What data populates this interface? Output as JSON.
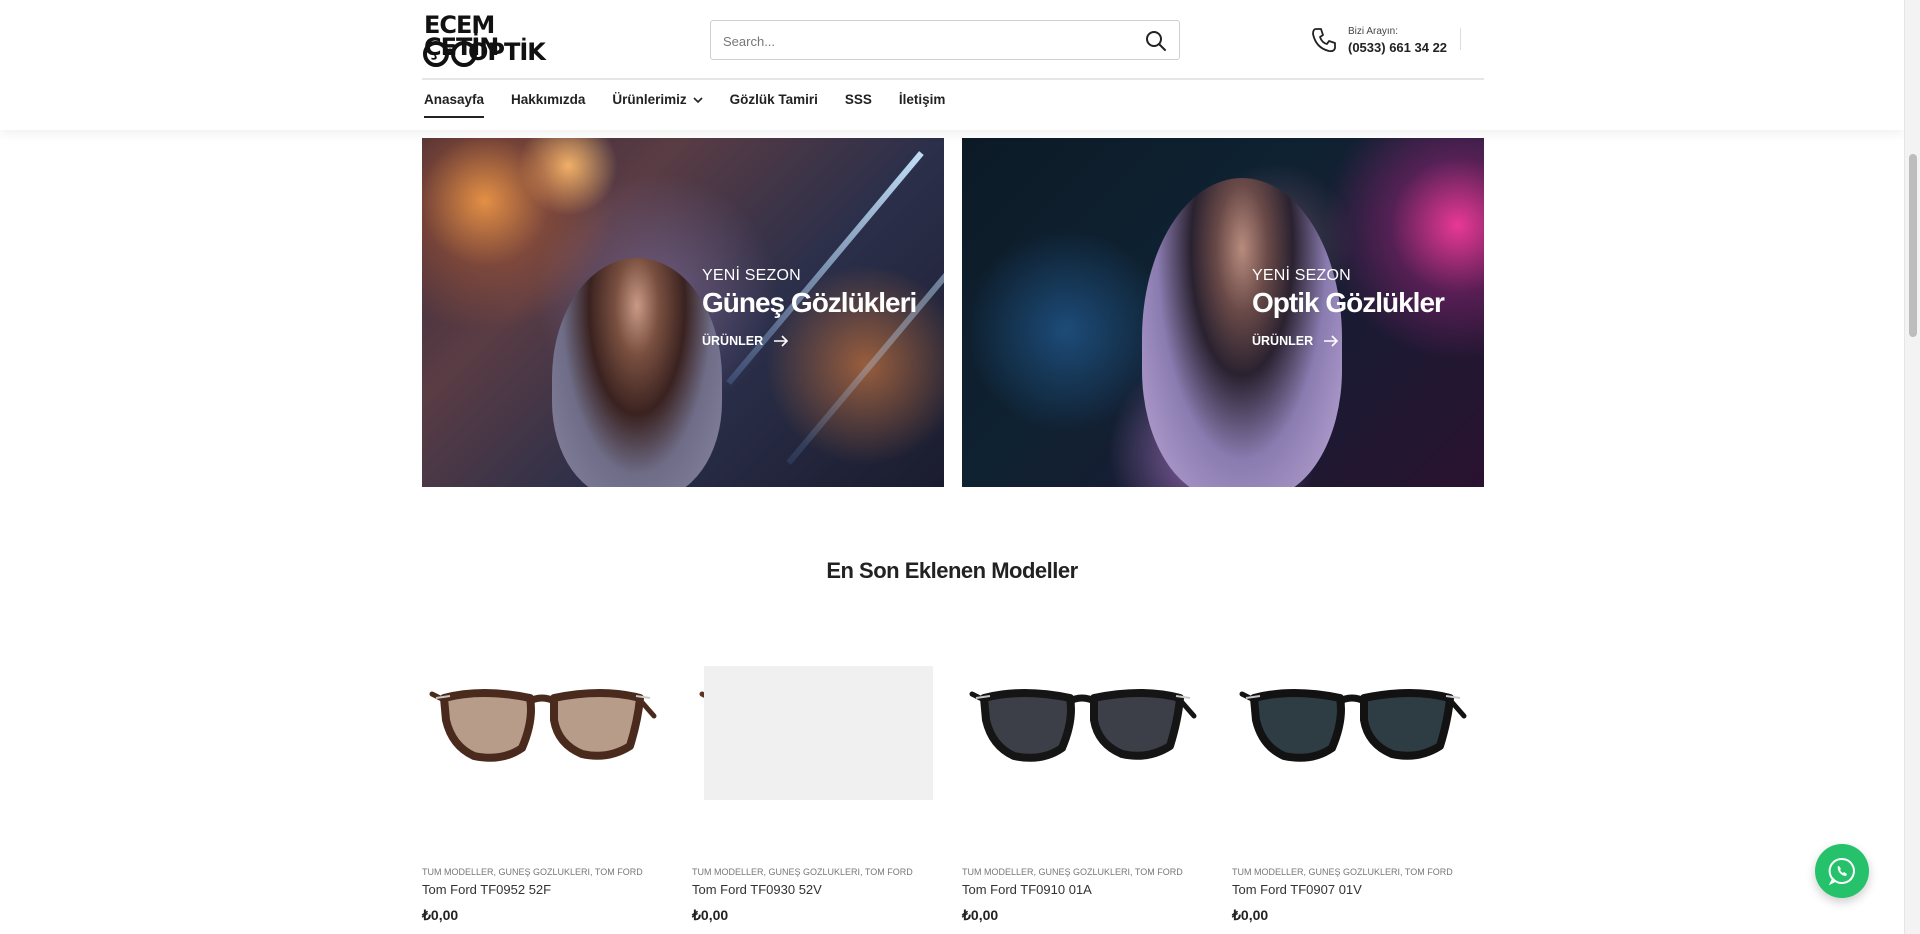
{
  "header": {
    "logo_line1": "ECEM ÇETİN",
    "logo_line2": "OPTİK",
    "search_placeholder": "Search...",
    "phone_label": "Bizi Arayın:",
    "phone_number": "(0533) 661 34 22"
  },
  "nav": {
    "items": [
      "Anasayfa",
      "Hakkımızda",
      "Ürünlerimiz",
      "Gözlük Tamiri",
      "SSS",
      "İletişim"
    ]
  },
  "banners": [
    {
      "subtitle": "YENİ SEZON",
      "title": "Güneş Gözlükleri",
      "link": "ÜRÜNLER"
    },
    {
      "subtitle": "YENİ SEZON",
      "title": "Optik Gözlükler",
      "link": "ÜRÜNLER"
    }
  ],
  "section": {
    "title": "En Son Eklenen Modeller"
  },
  "products": [
    {
      "categories": "TUM MODELLER, GUNEŞ GOZLUKLERI, TOM FORD",
      "name": "Tom Ford TF0952 52F",
      "price": "₺0,00",
      "frame": "#4a2a1c",
      "lens": "#b89c8a"
    },
    {
      "categories": "TUM MODELLER, GUNEŞ GOZLUKLERI, TOM FORD",
      "name": "Tom Ford TF0930 52V",
      "price": "₺0,00",
      "frame": "#5a3520",
      "lens": "#2f4a52"
    },
    {
      "categories": "TUM MODELLER, GUNEŞ GOZLUKLERI, TOM FORD",
      "name": "Tom Ford TF0910 01A",
      "price": "₺0,00",
      "frame": "#151515",
      "lens": "#3c3f48"
    },
    {
      "categories": "TUM MODELLER, GUNEŞ GOZLUKLERI, TOM FORD",
      "name": "Tom Ford TF0907 01V",
      "price": "₺0,00",
      "frame": "#121212",
      "lens": "#2e3c44"
    }
  ],
  "icons": {
    "search": "search-icon",
    "phone": "phone-icon",
    "chevron": "chevron-down-icon",
    "arrow": "arrow-right-icon",
    "whatsapp": "whatsapp-icon"
  },
  "colors": {
    "accent": "#222222",
    "whatsapp": "#25c26b"
  }
}
